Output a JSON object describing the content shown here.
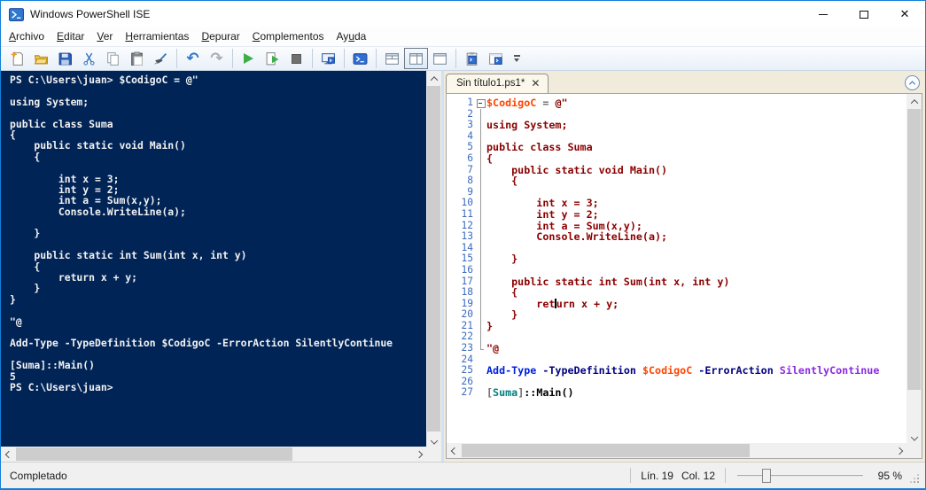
{
  "window": {
    "title": "Windows PowerShell ISE"
  },
  "menu": {
    "items": [
      {
        "label": "Archivo",
        "mnemonic": 0
      },
      {
        "label": "Editar",
        "mnemonic": 0
      },
      {
        "label": "Ver",
        "mnemonic": 0
      },
      {
        "label": "Herramientas",
        "mnemonic": 0
      },
      {
        "label": "Depurar",
        "mnemonic": 0
      },
      {
        "label": "Complementos",
        "mnemonic": 0
      },
      {
        "label": "Ayuda",
        "mnemonic": 2
      }
    ]
  },
  "toolbar": {
    "icons": [
      "new-script",
      "open-script",
      "save",
      "cut",
      "copy",
      "paste",
      "clear-console",
      "undo",
      "redo",
      "run-script",
      "run-selection",
      "stop-operation",
      "new-remote-powershell-tab",
      "start-powershell",
      "show-script-pane-top",
      "show-script-pane-right",
      "show-script-pane-maximized",
      "show-command-addon",
      "show-script-pane",
      "toolbar-overflow"
    ]
  },
  "console": {
    "lines": [
      "PS C:\\Users\\juan> $CodigoC = @\"",
      "",
      "using System;",
      "",
      "public class Suma",
      "{",
      "    public static void Main()",
      "    {",
      "",
      "        int x = 3;",
      "        int y = 2;",
      "        int a = Sum(x,y);",
      "        Console.WriteLine(a);",
      "",
      "    }",
      "",
      "    public static int Sum(int x, int y)",
      "    {",
      "        return x + y;",
      "    }",
      "}",
      "",
      "\"@",
      "",
      "Add-Type -TypeDefinition $CodigoC -ErrorAction SilentlyContinue",
      "",
      "[Suma]::Main()",
      "5",
      "PS C:\\Users\\juan>"
    ]
  },
  "editor": {
    "tab": {
      "label": "Sin título1.ps1*"
    },
    "lines": [
      {
        "n": 1,
        "fold": "box",
        "segs": [
          [
            "var",
            "$CodigoC"
          ],
          [
            "plain",
            " "
          ],
          [
            "op",
            "="
          ],
          [
            "plain",
            " "
          ],
          [
            "str",
            "@\""
          ]
        ]
      },
      {
        "n": 2,
        "fold": "mid",
        "segs": []
      },
      {
        "n": 3,
        "fold": "mid",
        "segs": [
          [
            "str",
            "using System;"
          ]
        ]
      },
      {
        "n": 4,
        "fold": "mid",
        "segs": []
      },
      {
        "n": 5,
        "fold": "mid",
        "segs": [
          [
            "str",
            "public class Suma"
          ]
        ]
      },
      {
        "n": 6,
        "fold": "mid",
        "segs": [
          [
            "str",
            "{"
          ]
        ]
      },
      {
        "n": 7,
        "fold": "mid",
        "segs": [
          [
            "str",
            "    public static void Main()"
          ]
        ]
      },
      {
        "n": 8,
        "fold": "mid",
        "segs": [
          [
            "str",
            "    {"
          ]
        ]
      },
      {
        "n": 9,
        "fold": "mid",
        "segs": []
      },
      {
        "n": 10,
        "fold": "mid",
        "segs": [
          [
            "str",
            "        int x = 3;"
          ]
        ]
      },
      {
        "n": 11,
        "fold": "mid",
        "segs": [
          [
            "str",
            "        int y = 2;"
          ]
        ]
      },
      {
        "n": 12,
        "fold": "mid",
        "segs": [
          [
            "str",
            "        int a = Sum(x,y);"
          ]
        ]
      },
      {
        "n": 13,
        "fold": "mid",
        "segs": [
          [
            "str",
            "        Console.WriteLine(a);"
          ]
        ]
      },
      {
        "n": 14,
        "fold": "mid",
        "segs": []
      },
      {
        "n": 15,
        "fold": "mid",
        "segs": [
          [
            "str",
            "    }"
          ]
        ]
      },
      {
        "n": 16,
        "fold": "mid",
        "segs": []
      },
      {
        "n": 17,
        "fold": "mid",
        "segs": [
          [
            "str",
            "    public static int Sum(int x, int y)"
          ]
        ]
      },
      {
        "n": 18,
        "fold": "mid",
        "segs": [
          [
            "str",
            "    {"
          ]
        ]
      },
      {
        "n": 19,
        "fold": "mid",
        "segs": [
          [
            "str",
            "        ret"
          ],
          [
            "caret",
            ""
          ],
          [
            "str",
            "urn x + y;"
          ]
        ]
      },
      {
        "n": 20,
        "fold": "mid",
        "segs": [
          [
            "str",
            "    }"
          ]
        ]
      },
      {
        "n": 21,
        "fold": "mid",
        "segs": [
          [
            "str",
            "}"
          ]
        ]
      },
      {
        "n": 22,
        "fold": "mid",
        "segs": []
      },
      {
        "n": 23,
        "fold": "end",
        "segs": [
          [
            "str",
            "\"@"
          ]
        ]
      },
      {
        "n": 24,
        "fold": null,
        "segs": []
      },
      {
        "n": 25,
        "fold": null,
        "segs": [
          [
            "cmd",
            "Add-Type"
          ],
          [
            "plain",
            " "
          ],
          [
            "param",
            "-TypeDefinition"
          ],
          [
            "plain",
            " "
          ],
          [
            "var",
            "$CodigoC"
          ],
          [
            "plain",
            " "
          ],
          [
            "param",
            "-ErrorAction"
          ],
          [
            "plain",
            " "
          ],
          [
            "arg",
            "SilentlyContinue"
          ]
        ]
      },
      {
        "n": 26,
        "fold": null,
        "segs": []
      },
      {
        "n": 27,
        "fold": null,
        "segs": [
          [
            "op",
            "["
          ],
          [
            "type",
            "Suma"
          ],
          [
            "op",
            "]"
          ],
          [
            "member",
            "::Main()"
          ]
        ]
      }
    ]
  },
  "status": {
    "state": "Completado",
    "line": "Lín. 19",
    "col": "Col. 12",
    "zoom": "95 %"
  },
  "colors": {
    "accent": "#1280D8",
    "console_bg": "#012456",
    "console_fg": "#F2F2F2",
    "tab_strip_bg": "#F1EBDB",
    "line_number": "#3B6BBF",
    "string": "#8B0000",
    "variable": "#FF4500",
    "command": "#0020E0",
    "parameter": "#000080",
    "argument": "#8A2BE2",
    "type": "#008080"
  }
}
